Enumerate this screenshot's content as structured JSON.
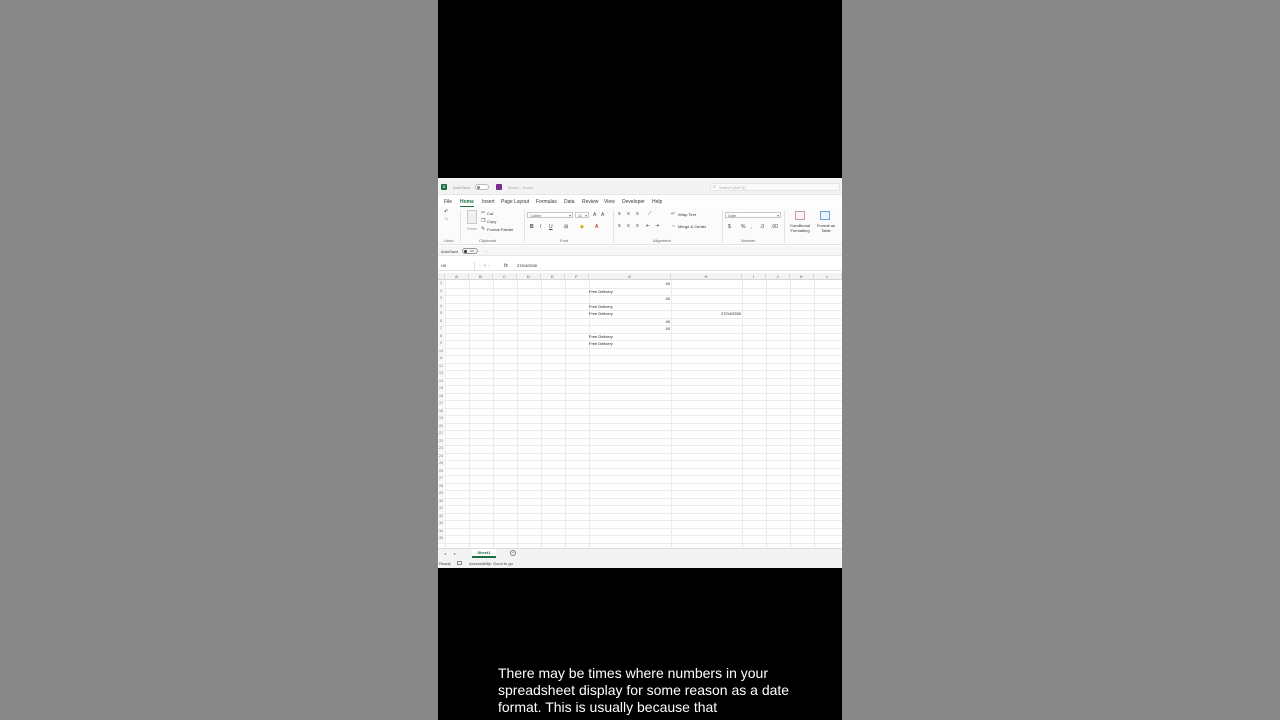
{
  "titlebar": {
    "autosave_label": "AutoSave",
    "toggle_text": "Off",
    "workbook": "Book1 - Excel",
    "search_placeholder": "Search (Alt+Q)"
  },
  "tabs": [
    "File",
    "Home",
    "Insert",
    "Page Layout",
    "Formulas",
    "Data",
    "Review",
    "View",
    "Developer",
    "Help"
  ],
  "active_tab": "Home",
  "ribbon": {
    "undo_group": "Undo",
    "clipboard": {
      "group": "Clipboard",
      "paste": "Paste",
      "cut": "Cut",
      "copy": "Copy",
      "format_painter": "Format Painter"
    },
    "font": {
      "group": "Font",
      "name": "Calibri",
      "size": "11",
      "bold": "B",
      "italic": "I",
      "underline": "U"
    },
    "alignment": {
      "group": "Alignment",
      "wrap": "Wrap Text",
      "merge": "Merge & Center"
    },
    "number": {
      "group": "Number",
      "format": "Date"
    },
    "styles": {
      "conditional": "Conditional Formatting",
      "format_table": "Format as Table"
    }
  },
  "autosave_row": {
    "label": "AutoSave",
    "state": "Off",
    "extra": "↑"
  },
  "formula_bar": {
    "name_box": "H5",
    "fx": "fx",
    "value": "27/04/2530"
  },
  "columns": [
    "A",
    "B",
    "C",
    "D",
    "E",
    "F",
    "G",
    "H",
    "I",
    "J",
    "K",
    "L"
  ],
  "rows": [
    "1",
    "2",
    "3",
    "4",
    "5",
    "6",
    "7",
    "8",
    "9",
    "10",
    "11",
    "12",
    "13",
    "14",
    "15",
    "16",
    "17",
    "18",
    "19",
    "20",
    "21",
    "22",
    "23",
    "24",
    "25",
    "26",
    "27",
    "28",
    "29",
    "30",
    "31",
    "32",
    "33",
    "34",
    "35"
  ],
  "cells": {
    "g1": "40",
    "f2": "Free Delivery",
    "g3": "40",
    "f4": "Free Delivery",
    "f5": "Free Delivery",
    "h5": "27/04/2530",
    "g6": "40",
    "g7": "40",
    "f8": "Free Delivery",
    "f9": "Free Delivery"
  },
  "sheet": {
    "tab": "Sheet1",
    "add": "+"
  },
  "status": {
    "ready": "Ready",
    "accessibility": "Accessibility: Good to go"
  },
  "caption": "There may be times where numbers in your spreadsheet display for some reason as a date format.  This is usually because that",
  "colors": {
    "accent": "#1d6f42",
    "background": "#888888",
    "frame": "#000000"
  }
}
